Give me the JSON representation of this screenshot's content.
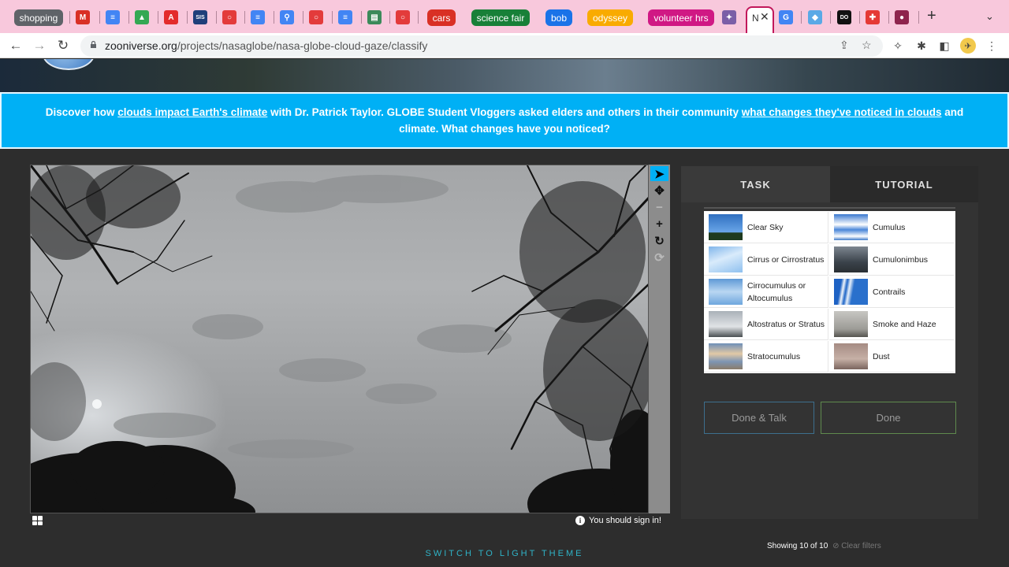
{
  "browser": {
    "tabs": [
      {
        "kind": "group",
        "label": "shopping",
        "color": "#5f6368"
      },
      {
        "kind": "icon",
        "icon": "gmail-icon",
        "glyph": "M",
        "color": "#d93025"
      },
      {
        "kind": "icon",
        "icon": "google-docs-icon",
        "glyph": "≡",
        "color": "#4285f4"
      },
      {
        "kind": "icon",
        "icon": "google-drive-icon",
        "glyph": "▲",
        "color": "#34a853"
      },
      {
        "kind": "icon",
        "icon": "adobe-icon",
        "glyph": "A",
        "color": "#e32b2b"
      },
      {
        "kind": "icon",
        "icon": "sis-icon",
        "glyph": "SIS",
        "color": "#1f3f7a"
      },
      {
        "kind": "icon",
        "icon": "loading-ring-icon",
        "glyph": "○",
        "color": "#e33b3b"
      },
      {
        "kind": "icon",
        "icon": "google-docs-icon",
        "glyph": "≡",
        "color": "#4285f4"
      },
      {
        "kind": "icon",
        "icon": "search-icon",
        "glyph": "⚲",
        "color": "#4285f4"
      },
      {
        "kind": "icon",
        "icon": "loading-ring-icon",
        "glyph": "○",
        "color": "#e33b3b"
      },
      {
        "kind": "icon",
        "icon": "google-docs-icon",
        "glyph": "≡",
        "color": "#4285f4"
      },
      {
        "kind": "icon",
        "icon": "sheets-icon",
        "glyph": "▤",
        "color": "#3b8a5a"
      },
      {
        "kind": "icon",
        "icon": "loading-ring-icon",
        "glyph": "○",
        "color": "#e33b3b"
      },
      {
        "kind": "group",
        "label": "cars",
        "color": "#d93025"
      },
      {
        "kind": "group",
        "label": "science fair",
        "color": "#188038"
      },
      {
        "kind": "group",
        "label": "bob",
        "color": "#1a73e8"
      },
      {
        "kind": "group",
        "label": "odyssey",
        "color": "#f9ab00"
      },
      {
        "kind": "group",
        "label": "volunteer hrs",
        "color": "#d01884"
      },
      {
        "kind": "icon",
        "icon": "alien-icon",
        "glyph": "✦",
        "color": "#7b5ea7"
      },
      {
        "kind": "active",
        "letter": "N"
      },
      {
        "kind": "icon",
        "icon": "google-icon",
        "glyph": "G",
        "color": "#4285f4"
      },
      {
        "kind": "icon",
        "icon": "puzzle-app-icon",
        "glyph": "◆",
        "color": "#5aa9e6"
      },
      {
        "kind": "icon",
        "icon": "do-icon",
        "glyph": "DO",
        "color": "#111111"
      },
      {
        "kind": "icon",
        "icon": "medical-cross-icon",
        "glyph": "✚",
        "color": "#e53935"
      },
      {
        "kind": "icon",
        "icon": "profile-circle-icon",
        "glyph": "●",
        "color": "#8e244d"
      }
    ],
    "url_domain": "zooniverse.org",
    "url_path": "/projects/nasaglobe/nasa-globe-cloud-gaze/classify"
  },
  "banner": {
    "part1": "Discover how ",
    "link1": "clouds impact Earth's climate",
    "part2": " with Dr. Patrick Taylor. GLOBE Student Vloggers asked elders and others in their community ",
    "link2": "what changes they've noticed in clouds",
    "part3": " and climate. What changes have you noticed?"
  },
  "viewer": {
    "signin": "You should sign in!"
  },
  "panel": {
    "tab_task": "TASK",
    "tab_tutorial": "TUTORIAL",
    "choices": [
      {
        "label": "Clear Sky",
        "thumb": "clear-sky-thumbnail"
      },
      {
        "label": "Cumulus",
        "thumb": "cumulus-thumbnail"
      },
      {
        "label": "Cirrus or Cirrostratus",
        "thumb": "cirrus-thumbnail"
      },
      {
        "label": "Cumulonimbus",
        "thumb": "cumulonimbus-thumbnail"
      },
      {
        "label": "Cirrocumulus or Altocumulus",
        "thumb": "cirrocumulus-thumbnail"
      },
      {
        "label": "Contrails",
        "thumb": "contrails-thumbnail"
      },
      {
        "label": "Altostratus or Stratus",
        "thumb": "altostratus-thumbnail"
      },
      {
        "label": "Smoke and Haze",
        "thumb": "smoke-haze-thumbnail"
      },
      {
        "label": "Stratocumulus",
        "thumb": "stratocumulus-thumbnail"
      },
      {
        "label": "Dust",
        "thumb": "dust-thumbnail"
      }
    ],
    "showing": "Showing 10 of 10",
    "clear_filters": "Clear filters",
    "done_talk": "Done & Talk",
    "done": "Done"
  },
  "footer": {
    "switch_theme": "SWITCH TO LIGHT THEME"
  }
}
